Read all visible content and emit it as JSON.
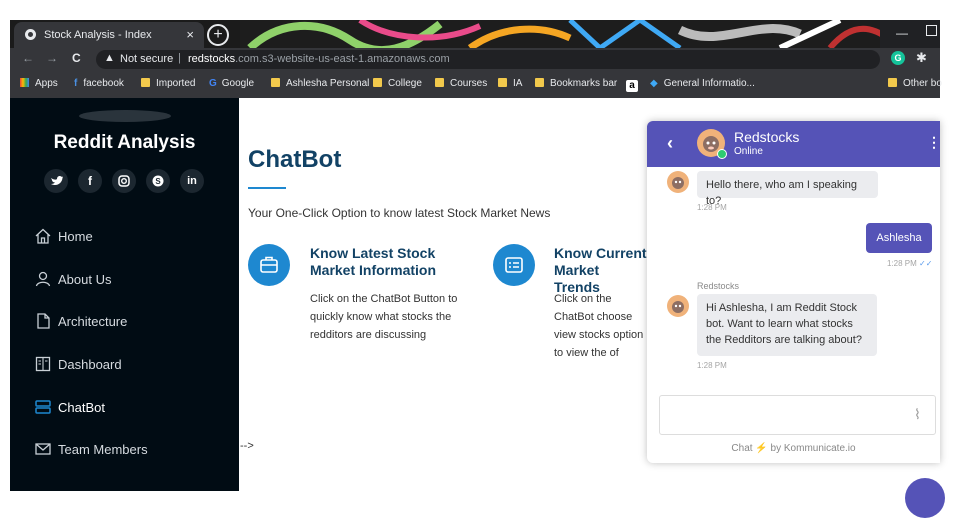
{
  "browser": {
    "tab_title": "Stock Analysis - Index",
    "tab_close": "×",
    "new_tab": "+",
    "not_secure": "Not secure",
    "url_host": "redstocks",
    "url_rest": ".com.s3-website-us-east-1.amazonaws.com",
    "bookmarks": [
      "Apps",
      "facebook",
      "Imported",
      "Google",
      "Ashlesha Personal",
      "College",
      "Courses",
      "IA",
      "Bookmarks bar",
      "General Informatio...",
      "Other bo"
    ]
  },
  "sidebar": {
    "brand": "Reddit Analysis",
    "social": [
      "twitter-icon",
      "facebook-icon",
      "instagram-icon",
      "skype-icon",
      "linkedin-icon"
    ],
    "items": [
      {
        "label": "Home",
        "icon": "home-icon"
      },
      {
        "label": "About Us",
        "icon": "user-icon"
      },
      {
        "label": "Architecture",
        "icon": "file-icon"
      },
      {
        "label": "Dashboard",
        "icon": "book-icon"
      },
      {
        "label": "ChatBot",
        "icon": "server-icon",
        "active": true
      },
      {
        "label": "Team Members",
        "icon": "envelope-icon"
      }
    ]
  },
  "main": {
    "title": "ChatBot",
    "subtitle": "Your One-Click Option to know latest Stock Market News",
    "features": [
      {
        "title": "Know Latest Stock Market Information",
        "desc": "Click on the ChatBot Button to quickly know what stocks the redditors are discussing"
      },
      {
        "title": "Know Current Market Trends",
        "desc": "Click on the ChatBot choose view stocks option to view the of stock Market"
      }
    ],
    "stray_text": "-->"
  },
  "chat": {
    "name": "Redstocks",
    "status": "Online",
    "messages": [
      {
        "from": "bot",
        "text": "Hello there, who am I speaking to?",
        "time": "1:28 PM"
      },
      {
        "from": "user",
        "text": "Ashlesha",
        "time": "1:28 PM"
      },
      {
        "from": "bot",
        "sender": "Redstocks",
        "text": "Hi Ashlesha, I am Reddit Stock bot. Want to learn what stocks the Redditors are talking about?",
        "time": "1:28 PM"
      }
    ],
    "input_value": "",
    "footer_prefix": "Chat",
    "footer_suffix": "by Kommunicate.io"
  },
  "colors": {
    "sidebar_bg": "#010c14",
    "heading": "#124265",
    "accent": "#1e88d0",
    "chat_header": "#5553b7",
    "chat_user_bubble": "#5553b7"
  }
}
